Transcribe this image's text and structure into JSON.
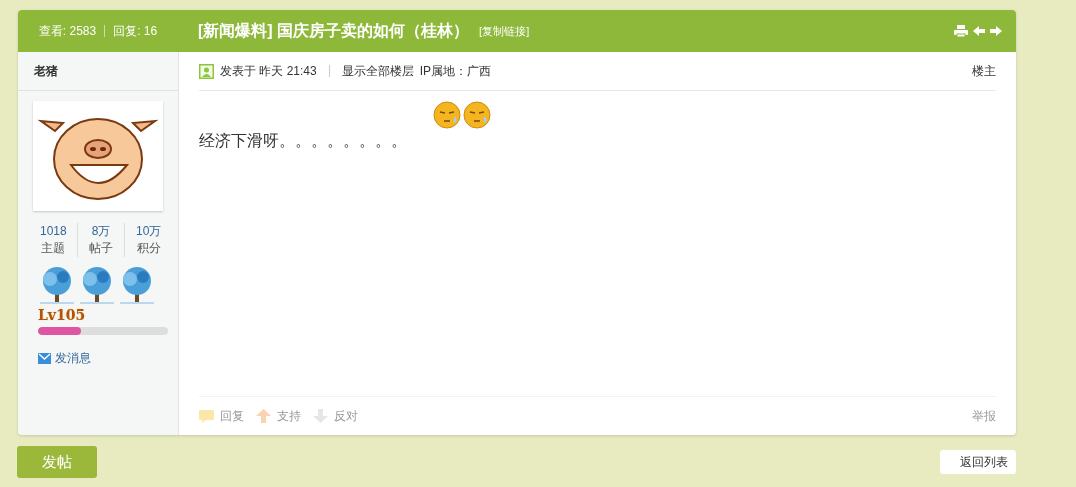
{
  "thread_header": {
    "views_label": "查看:",
    "views": "2583",
    "replies_label": "回复:",
    "replies": "16",
    "category": "[新闻爆料]",
    "title": "国庆房子卖的如何（桂林）",
    "copy_link": "[复制链接]"
  },
  "author": {
    "name": "老猪",
    "stats": [
      {
        "value": "1018",
        "label": "主题"
      },
      {
        "value": "8万",
        "label": "帖子"
      },
      {
        "value": "10万",
        "label": "积分"
      }
    ],
    "level_label": "Lv105",
    "progress": {
      "level": 0.33
    },
    "message_link": "发消息"
  },
  "post": {
    "posted": "发表于 昨天 21:43",
    "show_all": "显示全部楼层",
    "ip": "IP属地：广西",
    "floor": "楼主",
    "body": "经济下滑呀。。。。。。。。",
    "actions": [
      {
        "kind": "reply",
        "label": "回复"
      },
      {
        "kind": "support",
        "label": "支持"
      },
      {
        "kind": "oppose",
        "label": "反对"
      }
    ],
    "report": "举报"
  },
  "buttons": {
    "new_post": "发帖",
    "back_to_list": "返回列表"
  }
}
